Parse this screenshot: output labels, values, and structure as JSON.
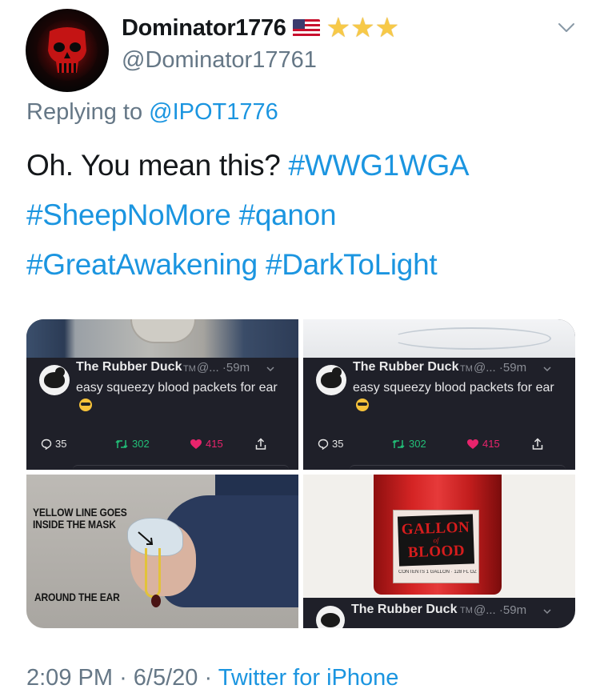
{
  "author": {
    "display_name": "Dominator1776",
    "handle": "@Dominator17761",
    "avatar_icon": "punisher-skull-icon",
    "name_badges": [
      "us-flag-icon",
      "star-icon",
      "star-icon",
      "star-icon"
    ]
  },
  "reply": {
    "prefix": "Replying to",
    "to": "@IPOT1776"
  },
  "tweet": {
    "lead": "Oh. You mean this?",
    "hashtags": [
      "#WWG1WGA",
      "#SheepNoMore",
      "#qanon",
      "#GreatAwakening",
      "#DarkToLight"
    ]
  },
  "media": {
    "card1": {
      "name": "The Rubber Duck",
      "tm": "TM",
      "meta": "@... ·59m",
      "text": "easy squeezy blood packets for ear",
      "replies": "35",
      "retweets": "302",
      "likes": "415"
    },
    "card2": {
      "name": "The Rubber Duck",
      "tm": "TM",
      "meta": "@... ·59m",
      "text": "easy squeezy blood packets for ear",
      "replies": "35",
      "retweets": "302",
      "likes": "415"
    },
    "photo3": {
      "caption_top": "YELLOW LINE GOES\nINSIDE THE MASK",
      "caption_bottom": "AROUND THE EAR"
    },
    "photo4": {
      "label_line1": "GALLON",
      "label_of": "of",
      "label_line2": "BLOOD",
      "label_contents": "CONTENTS 1 GALLON · 128 FL OZ (3.8L)",
      "overlay_name": "The Rubber Duck",
      "overlay_tm": "TM",
      "overlay_meta": "@... ·59m"
    }
  },
  "footer": {
    "time": "2:09 PM",
    "sep1": "·",
    "date": "6/5/20",
    "sep2": "·",
    "source": "Twitter for iPhone"
  },
  "colors": {
    "link": "#1b95e0",
    "muted": "#657786",
    "retweet": "#22bf78",
    "like": "#e8246c"
  }
}
